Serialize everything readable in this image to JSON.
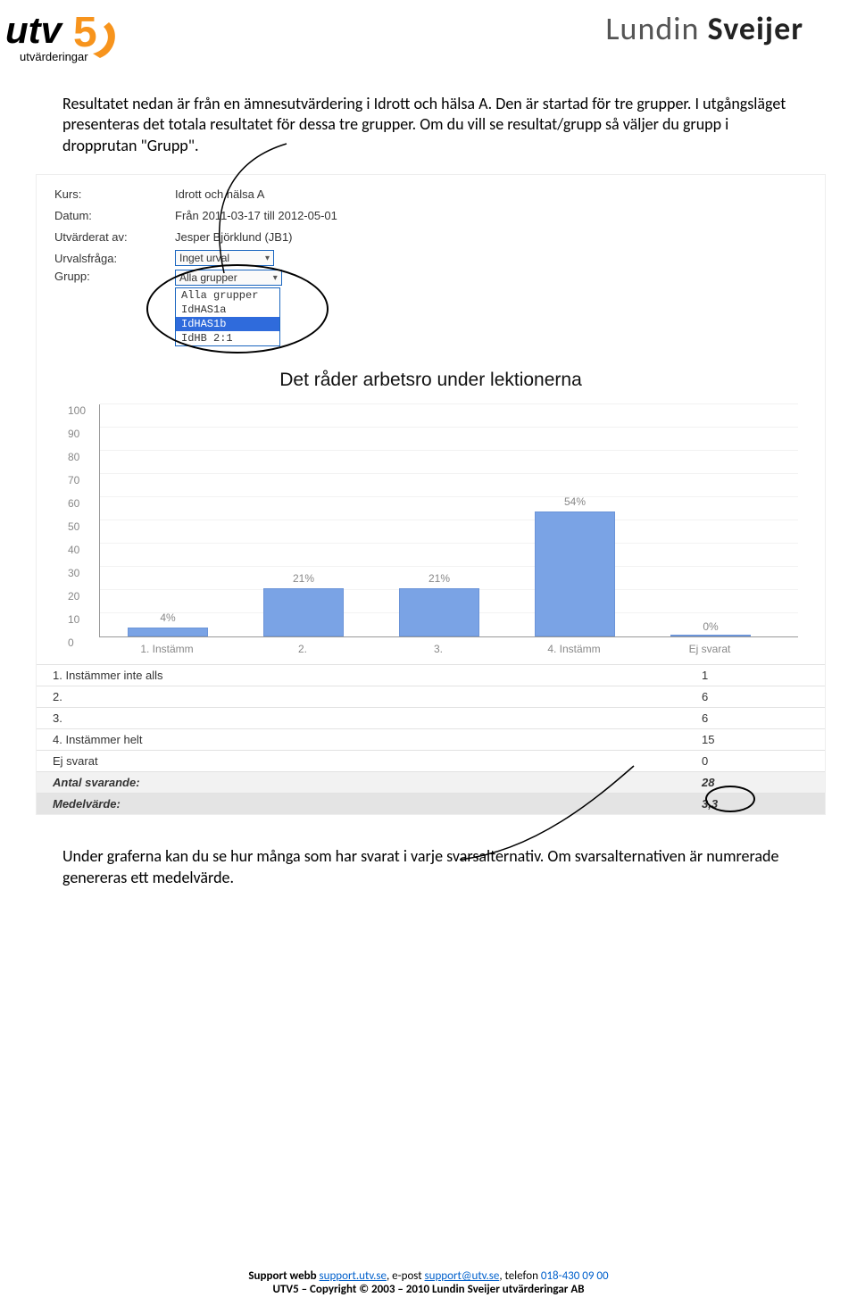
{
  "header": {
    "logo_left_top": "utv",
    "logo_left_five": "5",
    "logo_left_sub": "utvärderingar",
    "logo_right_light": "Lundin ",
    "logo_right_bold": "Sveijer"
  },
  "intro": "Resultatet nedan är från en ämnesutvärdering i Idrott och hälsa A. Den är startad för tre grupper. I utgångsläget presenteras det totala resultatet för dessa tre grupper. Om du vill se resultat/grupp så väljer du grupp i dropprutan \"Grupp\".",
  "meta": {
    "labels": {
      "kurs": "Kurs:",
      "datum": "Datum:",
      "utvarderat": "Utvärderat av:",
      "urvalsfraga": "Urvalsfråga:",
      "grupp": "Grupp:"
    },
    "values": {
      "kurs": "Idrott och hälsa A",
      "datum": "Från 2011-03-17 till 2012-05-01",
      "utvarderat": "Jesper Björklund (JB1)",
      "urval_select": "Inget urval",
      "grupp_select": "Alla grupper"
    },
    "dropdown": {
      "opt0": "Alla grupper",
      "opt1": "IdHAS1a",
      "opt2": "IdHAS1b",
      "opt3": "IdHB 2:1"
    }
  },
  "chart_data": {
    "type": "bar",
    "title": "Det råder arbetsro under lektionerna",
    "categories": [
      "1. Instämm",
      "2.",
      "3.",
      "4. Instämm",
      "Ej svarat"
    ],
    "values": [
      4,
      21,
      21,
      54,
      0
    ],
    "value_labels": [
      "4%",
      "21%",
      "21%",
      "54%",
      "0%"
    ],
    "ylabel": "",
    "xlabel": "",
    "ylim": [
      0,
      100
    ],
    "yticks": [
      0,
      10,
      20,
      30,
      40,
      50,
      60,
      70,
      80,
      90,
      100
    ]
  },
  "results": {
    "rows": [
      {
        "label": "1. Instämmer inte alls",
        "value": "1"
      },
      {
        "label": "2.",
        "value": "6"
      },
      {
        "label": "3.",
        "value": "6"
      },
      {
        "label": "4. Instämmer helt",
        "value": "15"
      },
      {
        "label": "Ej svarat",
        "value": "0"
      }
    ],
    "antal_label": "Antal svarande:",
    "antal_value": "28",
    "mean_label": "Medelvärde:",
    "mean_value": "3,3"
  },
  "outro": "Under graferna kan du se hur många som har svarat i varje svarsalternativ. Om svarsalternativen är numrerade genereras ett medelvärde.",
  "footer": {
    "support_prefix": "Support webb ",
    "support_link": "support.utv.se",
    "epost_prefix": ", e-post ",
    "epost_link": "support@utv.se",
    "tel_prefix": ", telefon ",
    "tel": "018-430 09 00",
    "line2": "UTV5 – Copyright © 2003 – 2010 Lundin Sveijer utvärderingar AB"
  }
}
